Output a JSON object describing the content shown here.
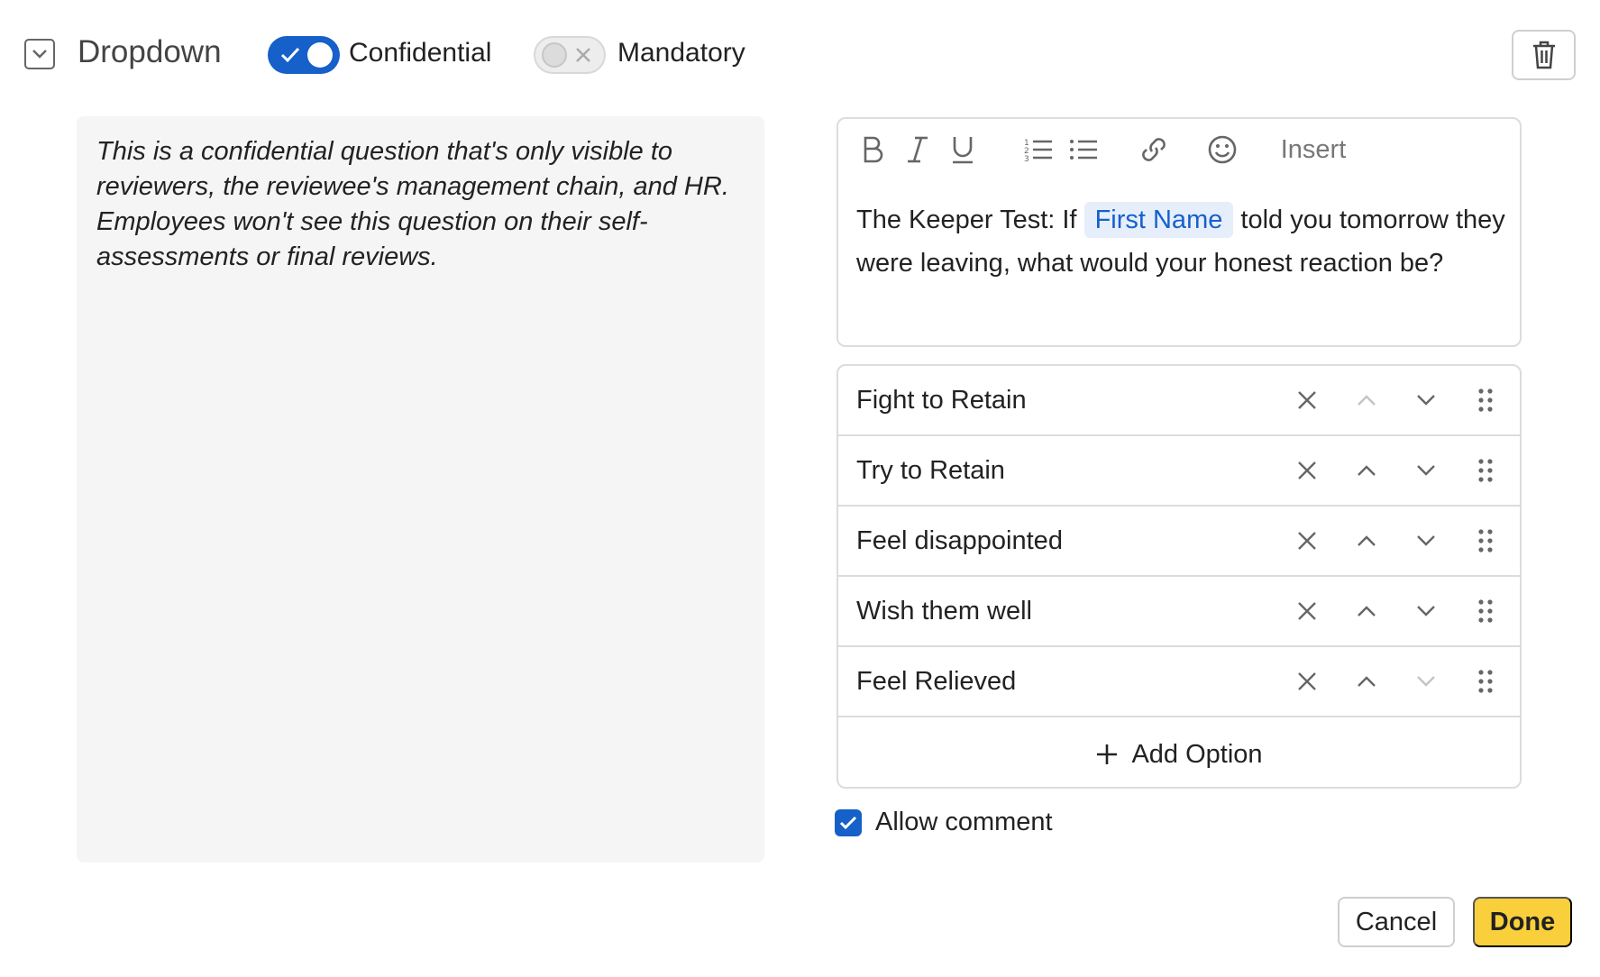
{
  "header": {
    "type_label": "Dropdown",
    "type_icon": "chevron-down-square-icon",
    "confidential": {
      "label": "Confidential",
      "on": true
    },
    "mandatory": {
      "label": "Mandatory",
      "on": false
    },
    "delete_icon": "trash-icon"
  },
  "note": {
    "text": "This is a confidential question that's only visible to reviewers, the reviewee's management chain, and HR. Employees won't see this question on their self-assessments or final reviews."
  },
  "editor": {
    "toolbar": {
      "bold_icon": "bold-icon",
      "italic_icon": "italic-icon",
      "underline_icon": "underline-icon",
      "ordered_list_icon": "ordered-list-icon",
      "bullet_list_icon": "bullet-list-icon",
      "link_icon": "link-icon",
      "emoji_icon": "emoji-icon",
      "insert_label": "Insert"
    },
    "question_prefix": "The Keeper Test: If",
    "placeholder_chip": "First Name",
    "question_suffix": "told you tomorrow they were leaving, what would your honest reaction be?"
  },
  "options": [
    {
      "label": "Fight to Retain",
      "up_enabled": false,
      "down_enabled": true
    },
    {
      "label": "Try to Retain",
      "up_enabled": true,
      "down_enabled": true
    },
    {
      "label": "Feel disappointed",
      "up_enabled": true,
      "down_enabled": true
    },
    {
      "label": "Wish them well",
      "up_enabled": true,
      "down_enabled": true
    },
    {
      "label": "Feel Relieved",
      "up_enabled": true,
      "down_enabled": false
    }
  ],
  "add_option_label": "Add Option",
  "allow_comment": {
    "label": "Allow comment",
    "checked": true
  },
  "buttons": {
    "cancel": "Cancel",
    "done": "Done"
  },
  "colors": {
    "accent": "#1660c9",
    "done_button": "#f9cf3b",
    "chip_bg": "#e6eefb",
    "panel_bg": "#f5f5f5"
  }
}
